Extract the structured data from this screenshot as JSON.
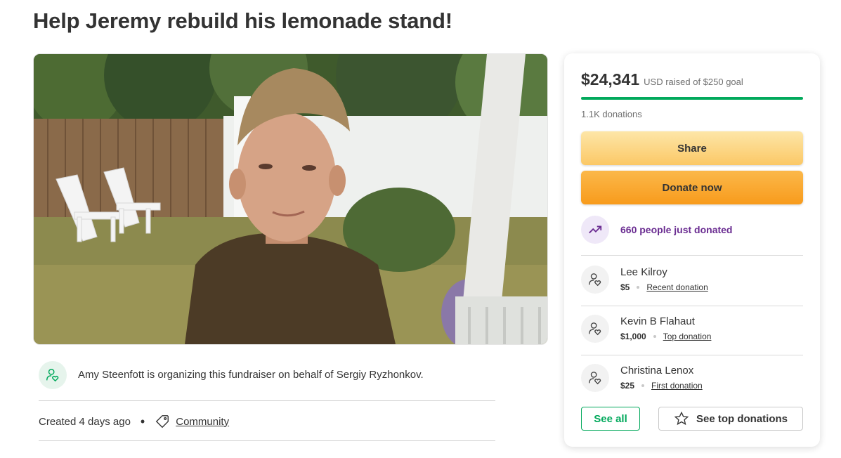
{
  "page": {
    "title": "Help Jeremy rebuild his lemonade stand!"
  },
  "hero": {
    "icon": "fundraiser-photo"
  },
  "organizer": {
    "text": "Amy Steenfott is organizing this fundraiser on behalf of Sergiy Ryzhonkov.",
    "icon": "organizer-heart-icon"
  },
  "meta": {
    "created": "Created 4 days ago",
    "separator": "•",
    "category": "Community",
    "icon": "tag-icon"
  },
  "card": {
    "amount_raised": "$24,341",
    "goal_text": "USD raised of $250 goal",
    "progress_fraction": 1.0,
    "donations_count": "1.1K donations",
    "share_label": "Share",
    "donate_label": "Donate now",
    "recent_activity": "660 people just donated",
    "recent_icon": "trending-up-icon",
    "donors": [
      {
        "name": "Lee Kilroy",
        "amount": "$5",
        "kind": "Recent donation"
      },
      {
        "name": "Kevin B Flahaut",
        "amount": "$1,000",
        "kind": "Top donation"
      },
      {
        "name": "Christina Lenox",
        "amount": "$25",
        "kind": "First donation"
      }
    ],
    "see_all_label": "See all",
    "see_top_label": "See top donations"
  },
  "colors": {
    "accent_green": "#02a95c",
    "donate_orange": "#f89b1c",
    "share_yellow": "#fbc866",
    "activity_purple": "#6a2c91"
  }
}
